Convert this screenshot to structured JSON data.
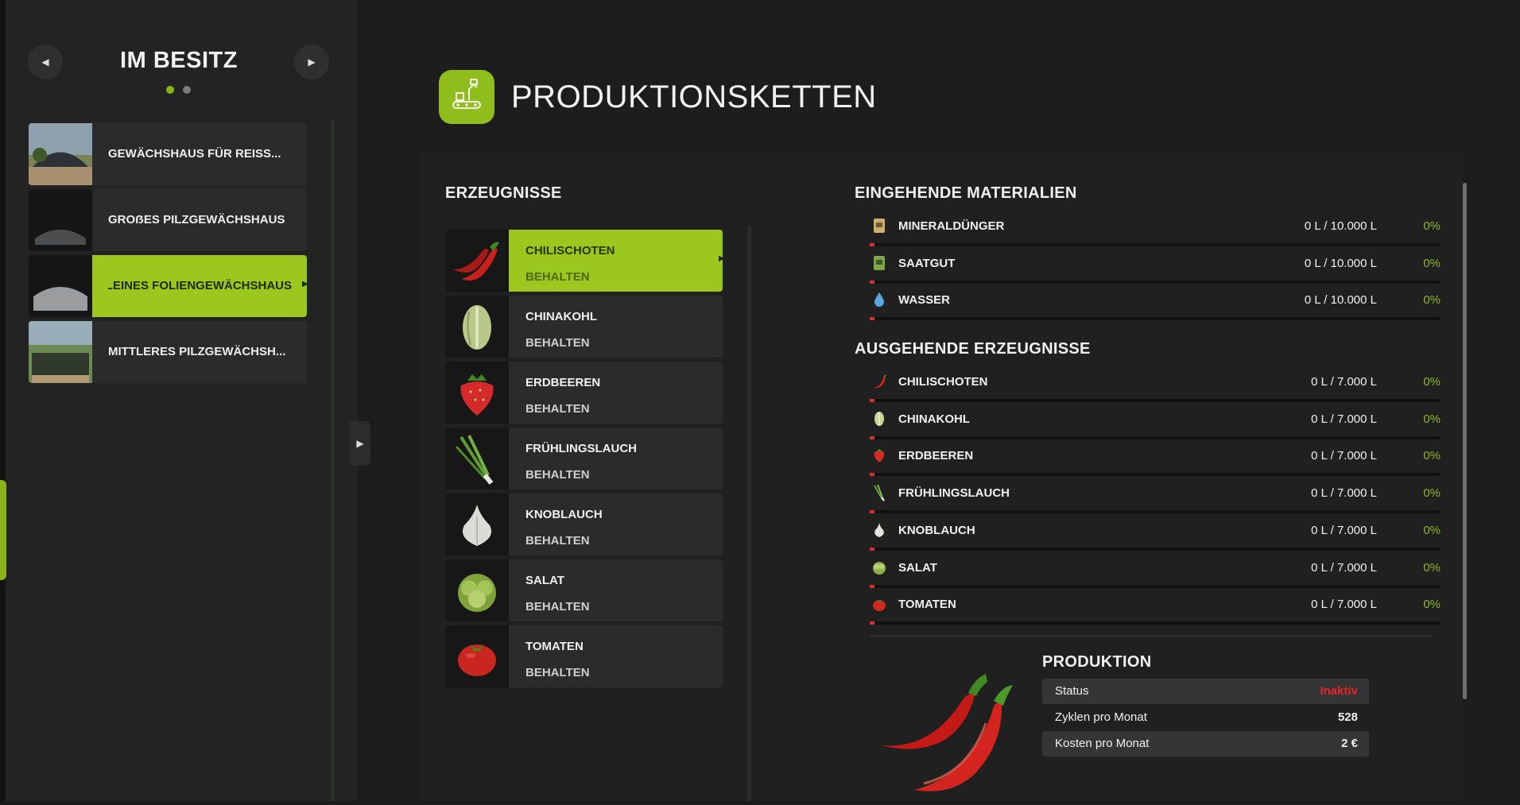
{
  "sidebar": {
    "title": "IM BESITZ",
    "prev_icon": "triangle-left-icon",
    "next_icon": "triangle-right-icon",
    "facilities": [
      {
        "label": "GEWÄCHSHAUS FÜR REISS...",
        "active": false
      },
      {
        "label": "GROẞES PILZGEWÄCHSHAUS",
        "active": false
      },
      {
        "label": "KLEINES FOLIENGEWÄCHSHAUS",
        "active": true
      },
      {
        "label": "MITTLERES PILZGEWÄCHSH...",
        "active": false
      }
    ]
  },
  "header": {
    "title": "PRODUKTIONSKETTEN",
    "icon": "production-chain-icon"
  },
  "products": {
    "title": "ERZEUGNISSE",
    "items": [
      {
        "name": "CHILISCHOTEN",
        "mode": "BEHALTEN",
        "icon": "chili-icon",
        "active": true
      },
      {
        "name": "CHINAKOHL",
        "mode": "BEHALTEN",
        "icon": "chinese-cabbage-icon",
        "active": false
      },
      {
        "name": "ERDBEEREN",
        "mode": "BEHALTEN",
        "icon": "strawberry-icon",
        "active": false
      },
      {
        "name": "FRÜHLINGSLAUCH",
        "mode": "BEHALTEN",
        "icon": "spring-onion-icon",
        "active": false
      },
      {
        "name": "KNOBLAUCH",
        "mode": "BEHALTEN",
        "icon": "garlic-icon",
        "active": false
      },
      {
        "name": "SALAT",
        "mode": "BEHALTEN",
        "icon": "lettuce-icon",
        "active": false
      },
      {
        "name": "TOMATEN",
        "mode": "BEHALTEN",
        "icon": "tomato-icon",
        "active": false
      }
    ]
  },
  "incoming": {
    "title": "EINGEHENDE MATERIALIEN",
    "items": [
      {
        "name": "MINERALDÜNGER",
        "value": "0 L / 10.000 L",
        "percent": "0%",
        "fill": 0,
        "icon": "fertilizer-icon"
      },
      {
        "name": "SAATGUT",
        "value": "0 L / 10.000 L",
        "percent": "0%",
        "fill": 0,
        "icon": "seed-bag-icon"
      },
      {
        "name": "WASSER",
        "value": "0 L / 10.000 L",
        "percent": "0%",
        "fill": 0,
        "icon": "water-drop-icon"
      }
    ]
  },
  "outgoing": {
    "title": "AUSGEHENDE ERZEUGNISSE",
    "items": [
      {
        "name": "CHILISCHOTEN",
        "value": "0 L / 7.000 L",
        "percent": "0%",
        "fill": 0,
        "icon": "chili-icon"
      },
      {
        "name": "CHINAKOHL",
        "value": "0 L / 7.000 L",
        "percent": "0%",
        "fill": 0,
        "icon": "chinese-cabbage-icon"
      },
      {
        "name": "ERDBEEREN",
        "value": "0 L / 7.000 L",
        "percent": "0%",
        "fill": 0,
        "icon": "strawberry-icon"
      },
      {
        "name": "FRÜHLINGSLAUCH",
        "value": "0 L / 7.000 L",
        "percent": "0%",
        "fill": 0,
        "icon": "spring-onion-icon"
      },
      {
        "name": "KNOBLAUCH",
        "value": "0 L / 7.000 L",
        "percent": "0%",
        "fill": 0,
        "icon": "garlic-icon"
      },
      {
        "name": "SALAT",
        "value": "0 L / 7.000 L",
        "percent": "0%",
        "fill": 0,
        "icon": "lettuce-icon"
      },
      {
        "name": "TOMATEN",
        "value": "0 L / 7.000 L",
        "percent": "0%",
        "fill": 0,
        "icon": "tomato-icon"
      }
    ]
  },
  "production": {
    "title": "PRODUKTION",
    "image": "chili-peppers-illustration",
    "rows": [
      {
        "key": "Status",
        "value": "Inaktiv",
        "value_color": "#e8262a"
      },
      {
        "key": "Zyklen pro Monat",
        "value": "528",
        "value_color": "#f0f0f0"
      },
      {
        "key": "Kosten pro Monat",
        "value": "2 €",
        "value_color": "#f0f0f0"
      }
    ]
  },
  "colors": {
    "accent": "#9bc71e",
    "status_inactive": "#e8262a",
    "percent": "#8db82a",
    "bar_fill": "#d43232"
  }
}
